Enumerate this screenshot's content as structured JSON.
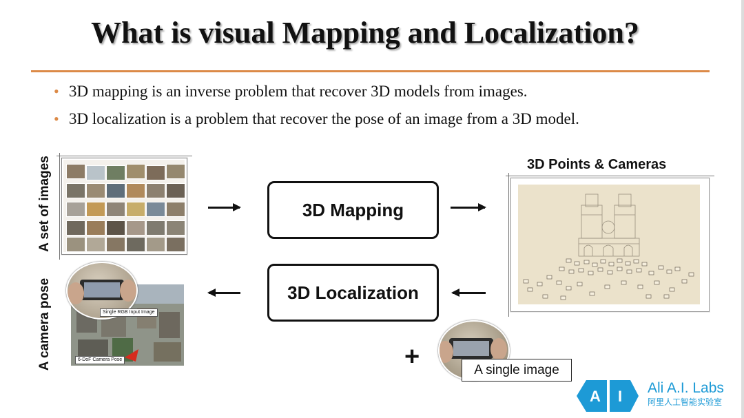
{
  "slide": {
    "title": "What is visual Mapping and Localization?",
    "bullets": [
      "3D mapping is an inverse problem that recover 3D models from images.",
      "3D localization is a problem that recover the pose of an image from a 3D model."
    ],
    "accent_color": "#dc8a47"
  },
  "diagram": {
    "left_label_top": "A set of images",
    "left_label_bottom": "A camera pose",
    "box_mapping": "3D Mapping",
    "box_localization": "3D Localization",
    "points_title": "3D Points & Cameras",
    "plus_sign": "+",
    "single_image_label": "A single image",
    "pose_tag_input": "Single RGB Input Image",
    "pose_tag_pose": "6-DoF Camera Pose"
  },
  "logo": {
    "letters": [
      "A",
      "I"
    ],
    "name": "Ali A.I. Labs",
    "chinese": "阿里人工智能实验室",
    "color": "#1d9ad6"
  }
}
